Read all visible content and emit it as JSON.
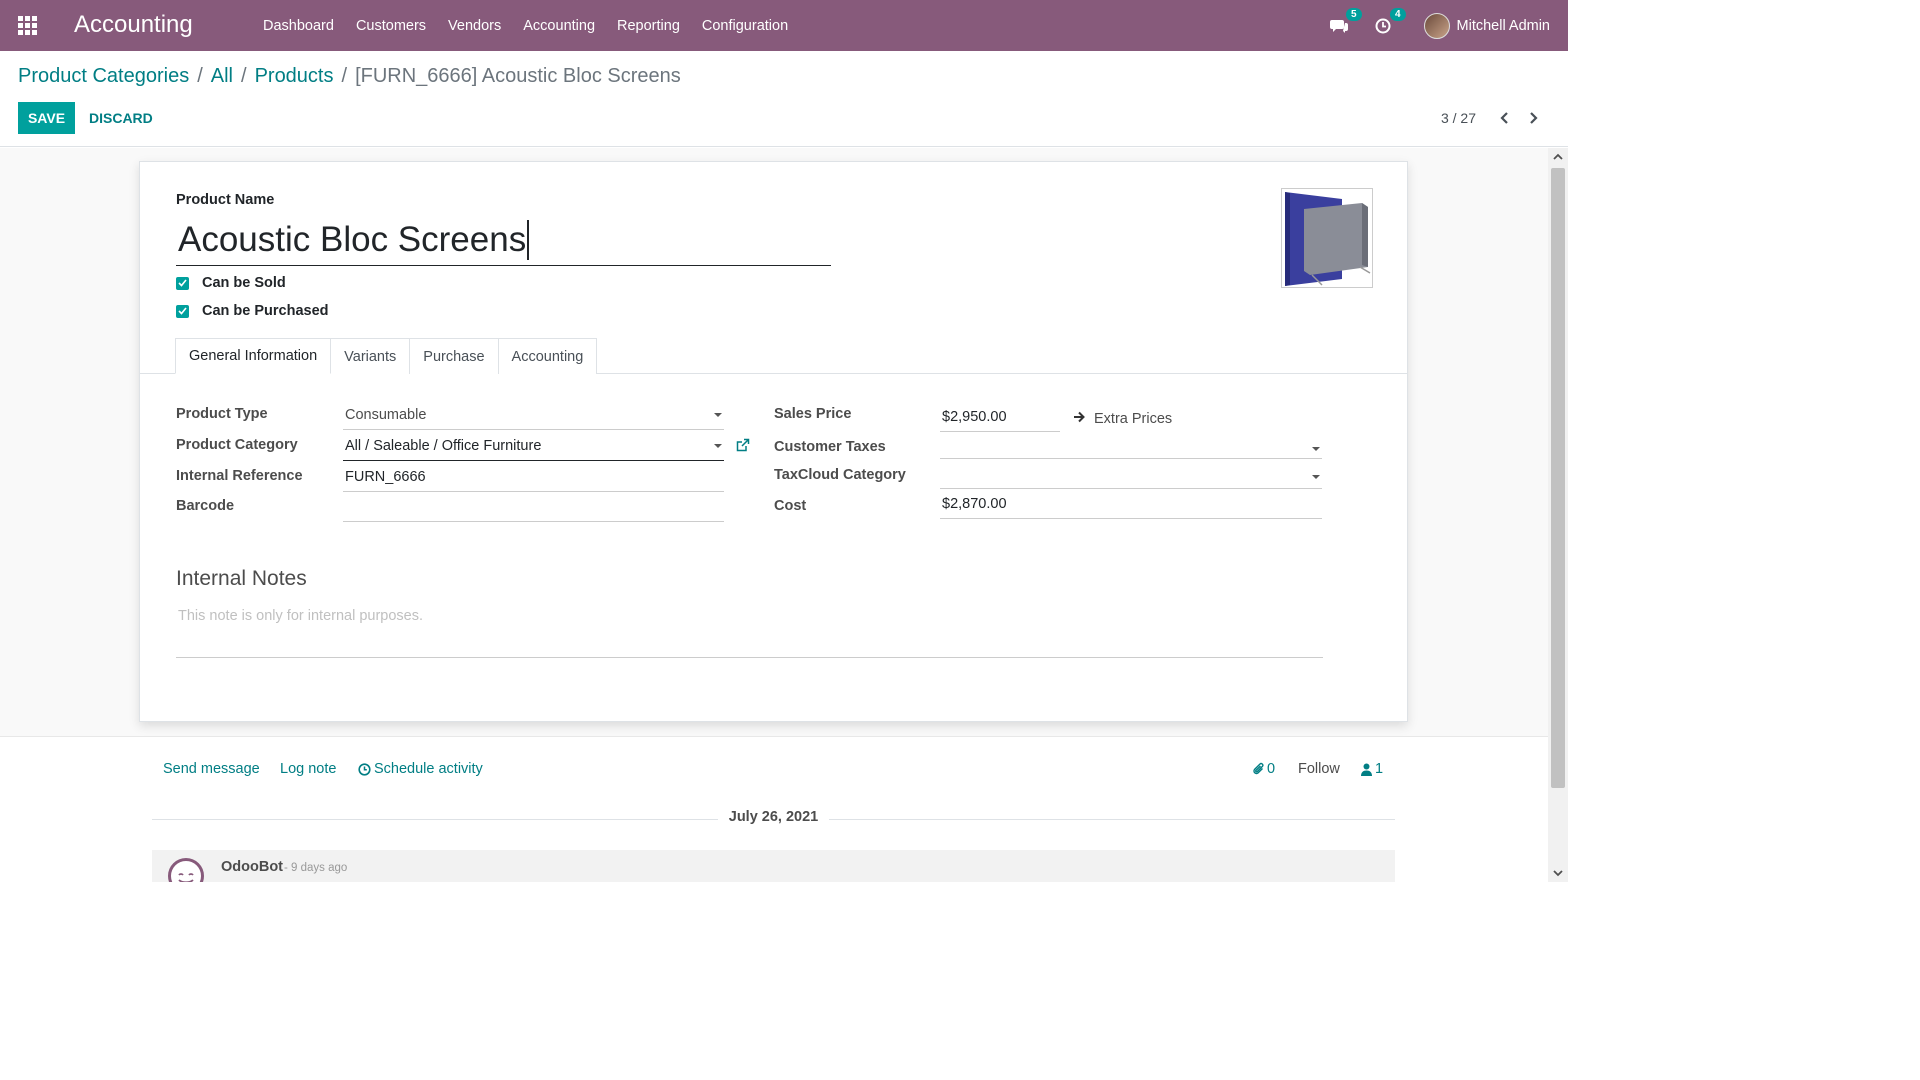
{
  "topbar": {
    "app_title": "Accounting",
    "nav": [
      "Dashboard",
      "Customers",
      "Vendors",
      "Accounting",
      "Reporting",
      "Configuration"
    ],
    "messages_badge": "5",
    "activities_badge": "4",
    "user_name": "Mitchell Admin"
  },
  "breadcrumb": {
    "items": [
      "Product Categories",
      "All",
      "Products"
    ],
    "current": "[FURN_6666] Acoustic Bloc Screens",
    "separator": "/"
  },
  "buttons": {
    "save": "SAVE",
    "discard": "DISCARD"
  },
  "pager": {
    "text": "3 / 27"
  },
  "form": {
    "product_name_label": "Product Name",
    "product_name": "Acoustic Bloc Screens",
    "can_be_sold_label": "Can be Sold",
    "can_be_sold": true,
    "can_be_purchased_label": "Can be Purchased",
    "can_be_purchased": true,
    "tabs": [
      "General Information",
      "Variants",
      "Purchase",
      "Accounting"
    ],
    "active_tab": "General Information",
    "fields": {
      "product_type": {
        "label": "Product Type",
        "value": "Consumable"
      },
      "product_category": {
        "label": "Product Category",
        "value": "All / Saleable / Office Furniture"
      },
      "internal_reference": {
        "label": "Internal Reference",
        "value": "FURN_6666"
      },
      "barcode": {
        "label": "Barcode",
        "value": ""
      },
      "sales_price": {
        "label": "Sales Price",
        "value": "$2,950.00"
      },
      "customer_taxes": {
        "label": "Customer Taxes",
        "value": ""
      },
      "taxcloud_category": {
        "label": "TaxCloud Category",
        "value": ""
      },
      "cost": {
        "label": "Cost",
        "value": "$2,870.00"
      }
    },
    "extra_prices": "Extra Prices",
    "internal_notes_title": "Internal Notes",
    "internal_notes_placeholder": "This note is only for internal purposes."
  },
  "chatter": {
    "send_message": "Send message",
    "log_note": "Log note",
    "schedule_activity": "Schedule activity",
    "attachments_count": "0",
    "follow": "Follow",
    "followers_count": "1",
    "date_separator": "July 26, 2021",
    "message_author": "OdooBot",
    "message_time": "- 9 days ago"
  },
  "colors": {
    "brand": "#875a7b",
    "accent": "#00a09d",
    "link": "#017e84"
  }
}
